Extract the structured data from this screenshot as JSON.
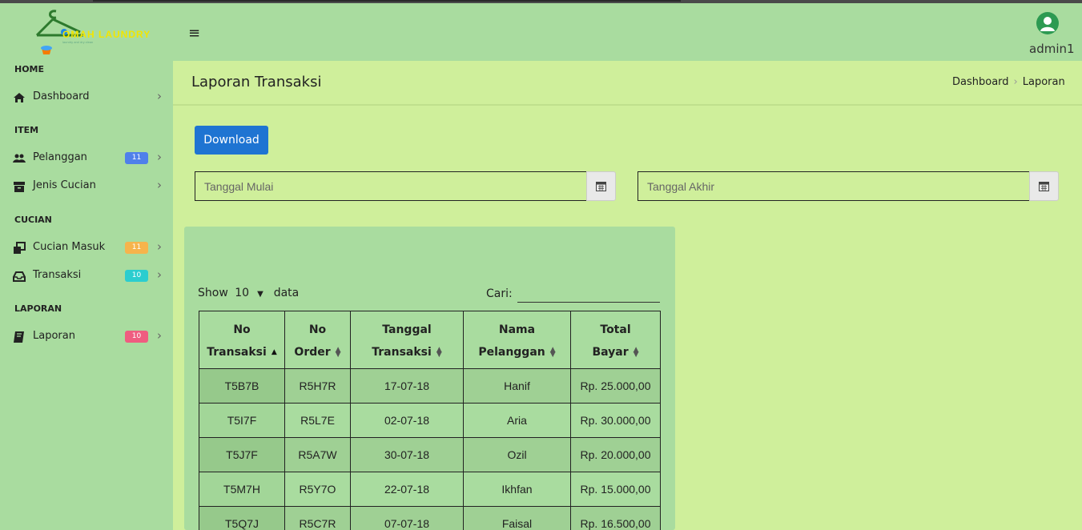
{
  "app": {
    "brand": "OMAH LAUNDRY",
    "brand_tagline": "laundry and dry clean",
    "user": "admin1",
    "accent": "#1e74d2"
  },
  "sidebar": {
    "sections": {
      "home": "HOME",
      "item": "ITEM",
      "cucian": "CUCIAN",
      "laporan": "LAPORAN"
    },
    "items": [
      {
        "label": "Dashboard",
        "icon": "home-icon",
        "badge": ""
      },
      {
        "label": "Pelanggan",
        "icon": "users-icon",
        "badge": "11",
        "badge_color": "#4f80ea"
      },
      {
        "label": "Jenis Cucian",
        "icon": "archive-icon",
        "badge": ""
      },
      {
        "label": "Cucian Masuk",
        "icon": "clone-icon",
        "badge": "11",
        "badge_color": "#f6b44c"
      },
      {
        "label": "Transaksi",
        "icon": "inbox-icon",
        "badge": "10",
        "badge_color": "#2bcdcf"
      },
      {
        "label": "Laporan",
        "icon": "book-icon",
        "badge": "10",
        "badge_color": "#ef5d80"
      }
    ]
  },
  "page": {
    "title": "Laporan Transaksi",
    "breadcrumb": [
      "Dashboard",
      "Laporan"
    ],
    "download_label": "Download",
    "start_date_placeholder": "Tanggal Mulai",
    "end_date_placeholder": "Tanggal Akhir"
  },
  "table": {
    "show_label": "Show",
    "page_size": "10",
    "data_label": "data",
    "search_label": "Cari:",
    "columns": [
      {
        "line1": "No",
        "line2": "Transaksi",
        "sort": "asc"
      },
      {
        "line1": "No",
        "line2": "Order",
        "sort": "both"
      },
      {
        "line1": "Tanggal",
        "line2": "Transaksi",
        "sort": "both"
      },
      {
        "line1": "Nama",
        "line2": "Pelanggan",
        "sort": "both"
      },
      {
        "line1": "Total",
        "line2": "Bayar",
        "sort": "both"
      }
    ],
    "rows": [
      [
        "T5B7B",
        "R5H7R",
        "17-07-18",
        "Hanif",
        "Rp. 25.000,00"
      ],
      [
        "T5I7F",
        "R5L7E",
        "02-07-18",
        "Aria",
        "Rp. 30.000,00"
      ],
      [
        "T5J7F",
        "R5A7W",
        "30-07-18",
        "Ozil",
        "Rp. 20.000,00"
      ],
      [
        "T5M7H",
        "R5Y7O",
        "22-07-18",
        "Ikhfan",
        "Rp. 15.000,00"
      ],
      [
        "T5Q7J",
        "R5C7R",
        "07-07-18",
        "Faisal",
        "Rp. 16.500,00"
      ]
    ]
  }
}
